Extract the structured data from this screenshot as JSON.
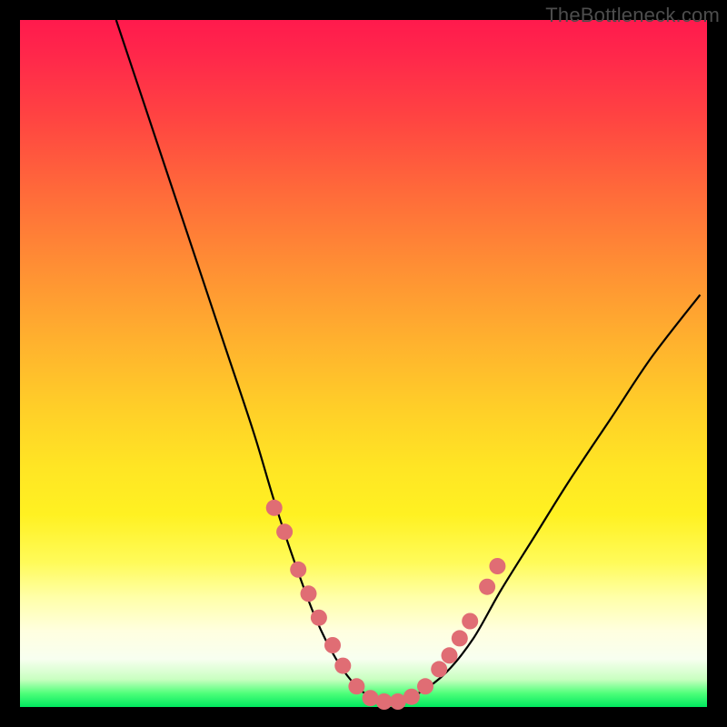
{
  "watermark": "TheBottleneck.com",
  "chart_data": {
    "type": "line",
    "title": "",
    "xlabel": "",
    "ylabel": "",
    "xlim": [
      0,
      100
    ],
    "ylim": [
      0,
      100
    ],
    "note": "Axes and units are not shown in the image; values below are normalized (0–100) estimates read from the plot dimensions.",
    "series": [
      {
        "name": "bottleneck-curve",
        "x": [
          14,
          18,
          22,
          26,
          30,
          34,
          37,
          40,
          43,
          46,
          49,
          52,
          55,
          58,
          62,
          66,
          70,
          75,
          80,
          86,
          92,
          99
        ],
        "y": [
          100,
          88,
          76,
          64,
          52,
          40,
          30,
          21,
          13,
          7,
          3,
          1,
          1,
          2,
          5,
          10,
          17,
          25,
          33,
          42,
          51,
          60
        ]
      }
    ],
    "markers": {
      "name": "sample-points",
      "x": [
        37.0,
        38.5,
        40.5,
        42.0,
        43.5,
        45.5,
        47.0,
        49.0,
        51.0,
        53.0,
        55.0,
        57.0,
        59.0,
        61.0,
        62.5,
        64.0,
        65.5,
        68.0,
        69.5
      ],
      "y": [
        29.0,
        25.5,
        20.0,
        16.5,
        13.0,
        9.0,
        6.0,
        3.0,
        1.3,
        0.8,
        0.8,
        1.5,
        3.0,
        5.5,
        7.5,
        10.0,
        12.5,
        17.5,
        20.5
      ]
    },
    "marker_style": {
      "color": "#e06d74",
      "radius_px": 9
    }
  }
}
